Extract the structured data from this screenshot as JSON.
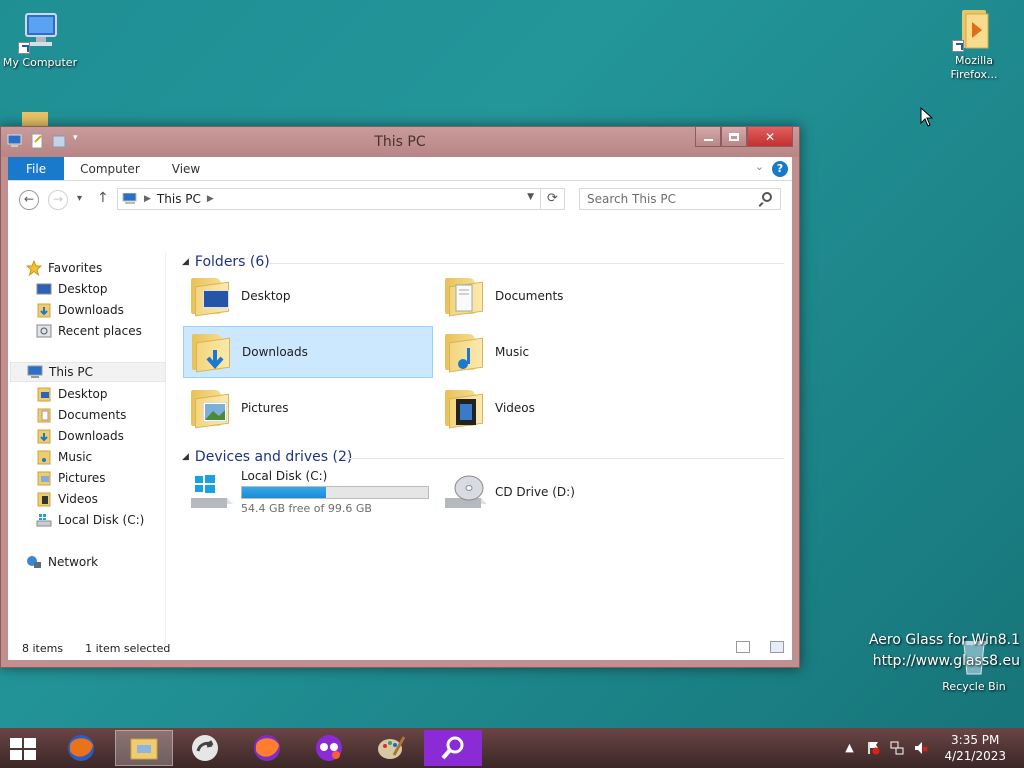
{
  "desktop": {
    "icons": [
      {
        "label": "My Computer"
      },
      {
        "label": "Mozilla Firefox..."
      },
      {
        "label": "Recycle Bin"
      }
    ],
    "watermark_line1": "Aero Glass for Win8.1",
    "watermark_line2": "http://www.glass8.eu"
  },
  "window": {
    "title": "This PC",
    "ribbon_tabs": [
      "File",
      "Computer",
      "View"
    ],
    "help_glyph": "?",
    "address": {
      "crumb": "This PC"
    },
    "search_placeholder": "Search This PC"
  },
  "nav_pane": {
    "favorites_label": "Favorites",
    "favorites": [
      "Desktop",
      "Downloads",
      "Recent places"
    ],
    "this_pc_label": "This PC",
    "this_pc_items": [
      "Desktop",
      "Documents",
      "Downloads",
      "Music",
      "Pictures",
      "Videos",
      "Local Disk (C:)"
    ],
    "network_label": "Network"
  },
  "content": {
    "folders_header": "Folders (6)",
    "folders": [
      "Desktop",
      "Documents",
      "Downloads",
      "Music",
      "Pictures",
      "Videos"
    ],
    "selected_folder": "Downloads",
    "drives_header": "Devices and drives (2)",
    "drives": [
      {
        "name": "Local Disk (C:)",
        "free_text": "54.4 GB free of 99.6 GB",
        "used_fraction": 0.454
      },
      {
        "name": "CD Drive (D:)"
      }
    ]
  },
  "status": {
    "items": "8 items",
    "selection": "1 item selected"
  },
  "taskbar": {
    "time": "3:35 PM",
    "date": "4/21/2023"
  },
  "colors": {
    "accent": "#1979ca",
    "selection": "#cce8ff",
    "window_frame": "#c08f8f",
    "desktop": "#1f8f94"
  }
}
